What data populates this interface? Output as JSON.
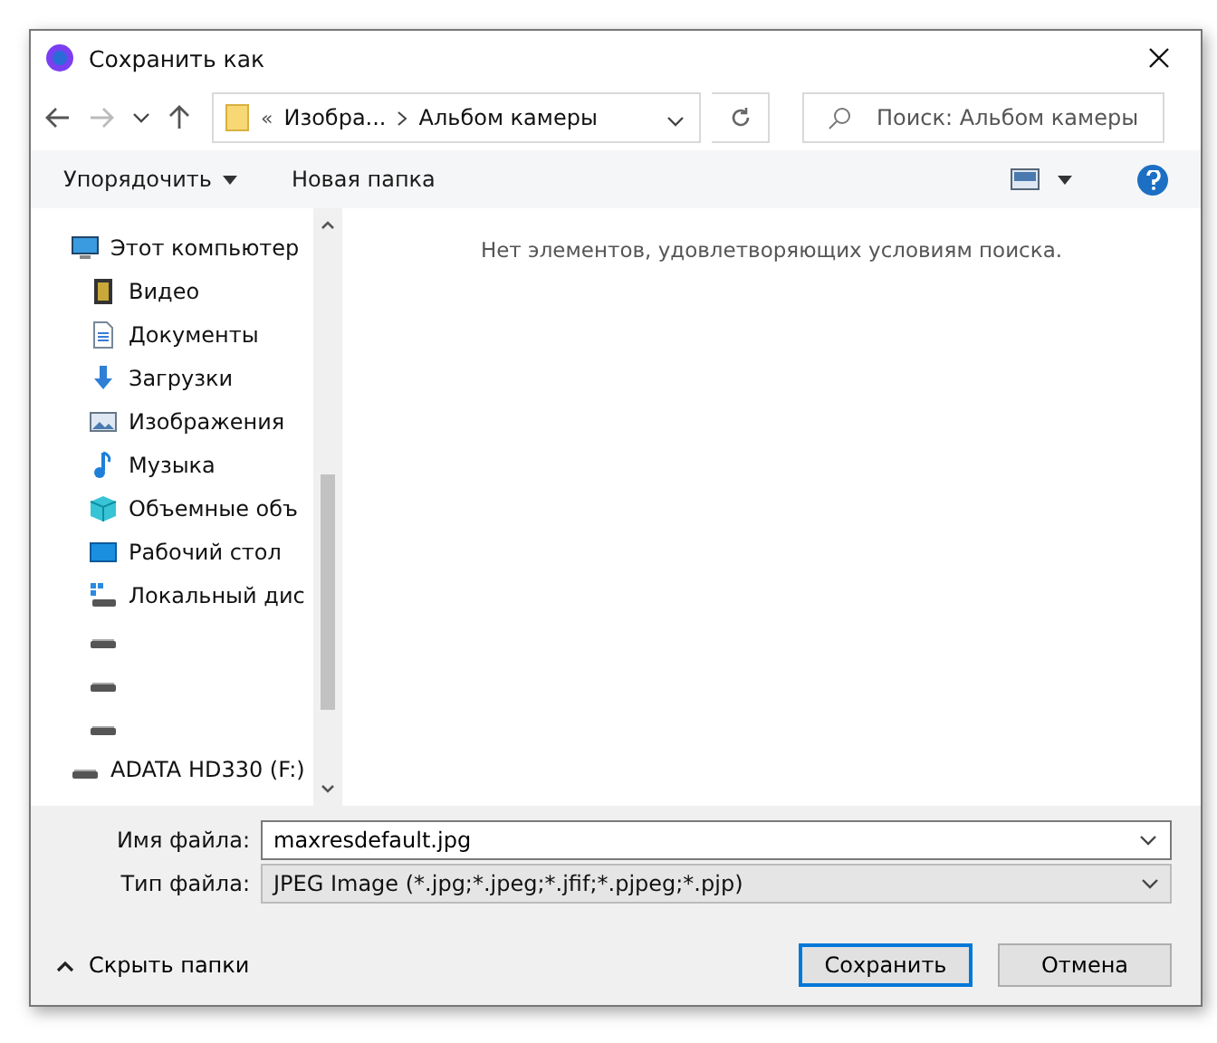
{
  "window": {
    "title": "Сохранить как"
  },
  "address": {
    "overflow": "«",
    "crumbs": [
      "Изобра...",
      "Альбом камеры"
    ]
  },
  "search": {
    "placeholder": "Поиск: Альбом камеры"
  },
  "toolbar": {
    "organize": "Упорядочить",
    "new_folder": "Новая папка"
  },
  "sidebar": {
    "items": [
      {
        "label": "Этот компьютер",
        "kind": "computer",
        "children": [
          {
            "label": "Видео",
            "kind": "video"
          },
          {
            "label": "Документы",
            "kind": "documents"
          },
          {
            "label": "Загрузки",
            "kind": "downloads"
          },
          {
            "label": "Изображения",
            "kind": "pictures"
          },
          {
            "label": "Музыка",
            "kind": "music"
          },
          {
            "label": "Объемные объ",
            "kind": "objects"
          },
          {
            "label": "Рабочий стол",
            "kind": "desktop"
          },
          {
            "label": "Локальный дис",
            "kind": "localdisk"
          },
          {
            "kind": "drive"
          },
          {
            "kind": "drive"
          },
          {
            "kind": "drive"
          }
        ]
      },
      {
        "label": "ADATA HD330 (F:)",
        "kind": "drive"
      }
    ]
  },
  "content": {
    "empty_message": "Нет элементов, удовлетворяющих условиям поиска."
  },
  "fields": [
    {
      "label": "Имя файла:",
      "value": "maxresdefault.jpg",
      "kind": "editable"
    },
    {
      "label": "Тип файла:",
      "value": "JPEG Image (*.jpg;*.jpeg;*.jfif;*.pjpeg;*.pjp)",
      "kind": "select"
    }
  ],
  "hide_folders": "Скрыть папки",
  "buttons": [
    {
      "label": "Сохранить",
      "kind": "default"
    },
    {
      "label": "Отмена",
      "kind": "normal"
    }
  ]
}
